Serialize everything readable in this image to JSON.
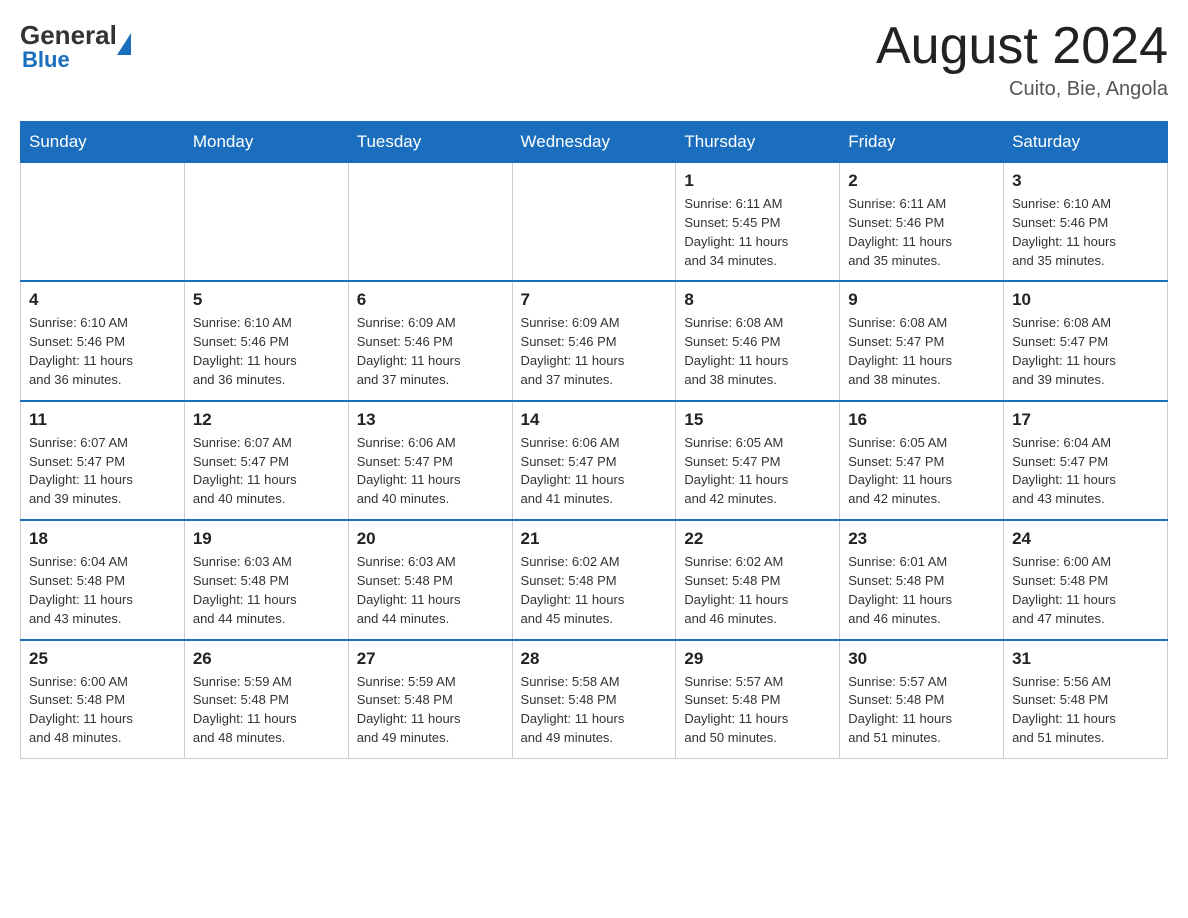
{
  "logo": {
    "general": "General",
    "blue": "Blue"
  },
  "header": {
    "title": "August 2024",
    "location": "Cuito, Bie, Angola"
  },
  "days_of_week": [
    "Sunday",
    "Monday",
    "Tuesday",
    "Wednesday",
    "Thursday",
    "Friday",
    "Saturday"
  ],
  "weeks": [
    [
      {
        "day": "",
        "info": ""
      },
      {
        "day": "",
        "info": ""
      },
      {
        "day": "",
        "info": ""
      },
      {
        "day": "",
        "info": ""
      },
      {
        "day": "1",
        "info": "Sunrise: 6:11 AM\nSunset: 5:45 PM\nDaylight: 11 hours\nand 34 minutes."
      },
      {
        "day": "2",
        "info": "Sunrise: 6:11 AM\nSunset: 5:46 PM\nDaylight: 11 hours\nand 35 minutes."
      },
      {
        "day": "3",
        "info": "Sunrise: 6:10 AM\nSunset: 5:46 PM\nDaylight: 11 hours\nand 35 minutes."
      }
    ],
    [
      {
        "day": "4",
        "info": "Sunrise: 6:10 AM\nSunset: 5:46 PM\nDaylight: 11 hours\nand 36 minutes."
      },
      {
        "day": "5",
        "info": "Sunrise: 6:10 AM\nSunset: 5:46 PM\nDaylight: 11 hours\nand 36 minutes."
      },
      {
        "day": "6",
        "info": "Sunrise: 6:09 AM\nSunset: 5:46 PM\nDaylight: 11 hours\nand 37 minutes."
      },
      {
        "day": "7",
        "info": "Sunrise: 6:09 AM\nSunset: 5:46 PM\nDaylight: 11 hours\nand 37 minutes."
      },
      {
        "day": "8",
        "info": "Sunrise: 6:08 AM\nSunset: 5:46 PM\nDaylight: 11 hours\nand 38 minutes."
      },
      {
        "day": "9",
        "info": "Sunrise: 6:08 AM\nSunset: 5:47 PM\nDaylight: 11 hours\nand 38 minutes."
      },
      {
        "day": "10",
        "info": "Sunrise: 6:08 AM\nSunset: 5:47 PM\nDaylight: 11 hours\nand 39 minutes."
      }
    ],
    [
      {
        "day": "11",
        "info": "Sunrise: 6:07 AM\nSunset: 5:47 PM\nDaylight: 11 hours\nand 39 minutes."
      },
      {
        "day": "12",
        "info": "Sunrise: 6:07 AM\nSunset: 5:47 PM\nDaylight: 11 hours\nand 40 minutes."
      },
      {
        "day": "13",
        "info": "Sunrise: 6:06 AM\nSunset: 5:47 PM\nDaylight: 11 hours\nand 40 minutes."
      },
      {
        "day": "14",
        "info": "Sunrise: 6:06 AM\nSunset: 5:47 PM\nDaylight: 11 hours\nand 41 minutes."
      },
      {
        "day": "15",
        "info": "Sunrise: 6:05 AM\nSunset: 5:47 PM\nDaylight: 11 hours\nand 42 minutes."
      },
      {
        "day": "16",
        "info": "Sunrise: 6:05 AM\nSunset: 5:47 PM\nDaylight: 11 hours\nand 42 minutes."
      },
      {
        "day": "17",
        "info": "Sunrise: 6:04 AM\nSunset: 5:47 PM\nDaylight: 11 hours\nand 43 minutes."
      }
    ],
    [
      {
        "day": "18",
        "info": "Sunrise: 6:04 AM\nSunset: 5:48 PM\nDaylight: 11 hours\nand 43 minutes."
      },
      {
        "day": "19",
        "info": "Sunrise: 6:03 AM\nSunset: 5:48 PM\nDaylight: 11 hours\nand 44 minutes."
      },
      {
        "day": "20",
        "info": "Sunrise: 6:03 AM\nSunset: 5:48 PM\nDaylight: 11 hours\nand 44 minutes."
      },
      {
        "day": "21",
        "info": "Sunrise: 6:02 AM\nSunset: 5:48 PM\nDaylight: 11 hours\nand 45 minutes."
      },
      {
        "day": "22",
        "info": "Sunrise: 6:02 AM\nSunset: 5:48 PM\nDaylight: 11 hours\nand 46 minutes."
      },
      {
        "day": "23",
        "info": "Sunrise: 6:01 AM\nSunset: 5:48 PM\nDaylight: 11 hours\nand 46 minutes."
      },
      {
        "day": "24",
        "info": "Sunrise: 6:00 AM\nSunset: 5:48 PM\nDaylight: 11 hours\nand 47 minutes."
      }
    ],
    [
      {
        "day": "25",
        "info": "Sunrise: 6:00 AM\nSunset: 5:48 PM\nDaylight: 11 hours\nand 48 minutes."
      },
      {
        "day": "26",
        "info": "Sunrise: 5:59 AM\nSunset: 5:48 PM\nDaylight: 11 hours\nand 48 minutes."
      },
      {
        "day": "27",
        "info": "Sunrise: 5:59 AM\nSunset: 5:48 PM\nDaylight: 11 hours\nand 49 minutes."
      },
      {
        "day": "28",
        "info": "Sunrise: 5:58 AM\nSunset: 5:48 PM\nDaylight: 11 hours\nand 49 minutes."
      },
      {
        "day": "29",
        "info": "Sunrise: 5:57 AM\nSunset: 5:48 PM\nDaylight: 11 hours\nand 50 minutes."
      },
      {
        "day": "30",
        "info": "Sunrise: 5:57 AM\nSunset: 5:48 PM\nDaylight: 11 hours\nand 51 minutes."
      },
      {
        "day": "31",
        "info": "Sunrise: 5:56 AM\nSunset: 5:48 PM\nDaylight: 11 hours\nand 51 minutes."
      }
    ]
  ]
}
